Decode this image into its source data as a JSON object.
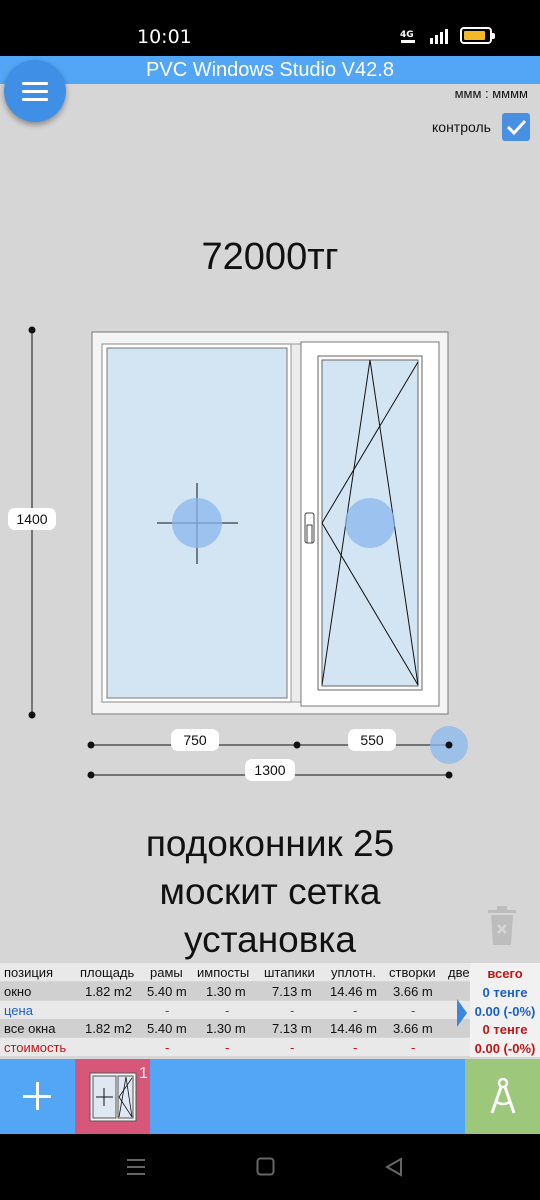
{
  "status_bar": {
    "time": "10:01",
    "network": "4G"
  },
  "app": {
    "title": "PVC Windows Studio V42.8"
  },
  "units": "ммм : мммм",
  "control": {
    "label": "контроль",
    "checked": true
  },
  "price": "72000тг",
  "window": {
    "height_label": "1400",
    "sash_widths": [
      "750",
      "550"
    ],
    "total_width": "1300"
  },
  "notes": [
    "подоконник 25",
    "москит сетка",
    "установка"
  ],
  "table": {
    "headers": [
      "позиция",
      "площадь",
      "рамы",
      "импосты",
      "штапики",
      "уплотн.",
      "створки",
      "две"
    ],
    "total_header": "всего",
    "rows": [
      {
        "label": "окно",
        "values": [
          "1.82 m2",
          "5.40 m",
          "1.30 m",
          "7.13 m",
          "14.46 m",
          "3.66 m"
        ],
        "total": "0 тенге"
      },
      {
        "label": "цена",
        "values": [
          "-",
          "-",
          "-",
          "-",
          "-",
          "-"
        ],
        "total": "0.00 (-0%)"
      },
      {
        "label": "все окна",
        "values": [
          "1.82 m2",
          "5.40 m",
          "1.30 m",
          "7.13 m",
          "14.46 m",
          "3.66 m"
        ],
        "total": "0 тенге"
      },
      {
        "label": "стоимость",
        "values": [
          "",
          "-",
          "-",
          "-",
          "-",
          "-"
        ],
        "total": "0.00 (-0%)"
      }
    ]
  },
  "bottom_bar": {
    "window_count": "1"
  },
  "colors": {
    "accent": "#52a6f5",
    "fab": "#3f8fe6",
    "thumb": "#d6577a",
    "measure": "#9dc77a",
    "total_blue": "#1a5fc9",
    "total_red": "#c01616"
  }
}
